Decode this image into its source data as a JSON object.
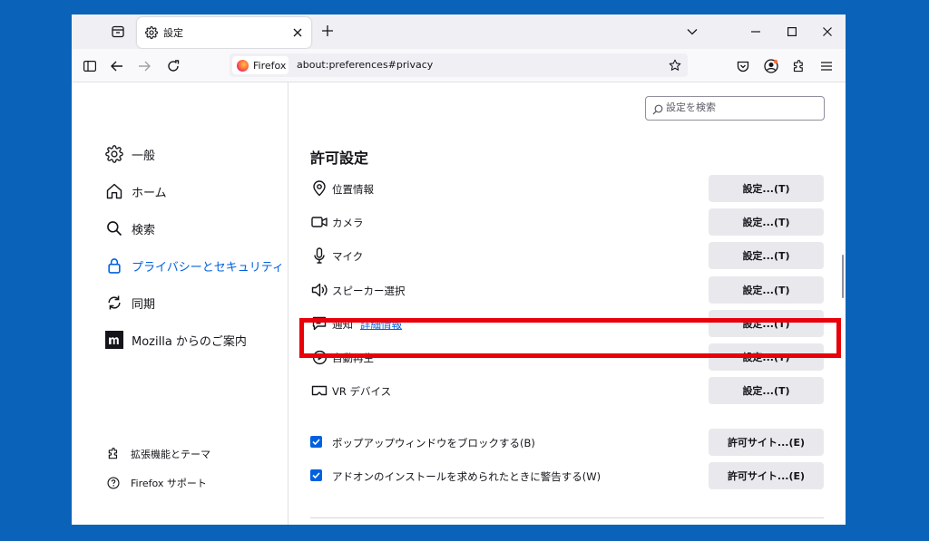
{
  "browser": {
    "tab_title": "設定",
    "identity_label": "Firefox",
    "url": "about:preferences#privacy"
  },
  "sidebar": {
    "categories": [
      {
        "label": "一般",
        "icon": "gear-icon"
      },
      {
        "label": "ホーム",
        "icon": "home-icon"
      },
      {
        "label": "検索",
        "icon": "search-icon"
      },
      {
        "label": "プライバシーとセキュリティ",
        "icon": "lock-icon",
        "selected": true
      },
      {
        "label": "同期",
        "icon": "sync-icon"
      },
      {
        "label": "Mozilla からのご案内",
        "icon": "mozilla-icon"
      }
    ],
    "footer": [
      {
        "label": "拡張機能とテーマ",
        "icon": "puzzle-icon"
      },
      {
        "label": "Firefox サポート",
        "icon": "help-icon"
      }
    ]
  },
  "search": {
    "placeholder": "設定を検索"
  },
  "permissions": {
    "heading": "許可設定",
    "button_label": "設定...(T)",
    "items": [
      {
        "label": "位置情報",
        "icon": "location-icon"
      },
      {
        "label": "カメラ",
        "icon": "camera-icon"
      },
      {
        "label": "マイク",
        "icon": "microphone-icon"
      },
      {
        "label": "スピーカー選択",
        "icon": "speaker-icon"
      },
      {
        "label": "通知",
        "icon": "notification-icon",
        "link": "詳細情報"
      },
      {
        "label": "自動再生",
        "icon": "autoplay-icon"
      },
      {
        "label": "VR デバイス",
        "icon": "vr-icon"
      }
    ],
    "checkboxes": [
      {
        "label": "ポップアップウィンドウをブロックする(B)",
        "checked": true,
        "button": "許可サイト...(E)"
      },
      {
        "label": "アドオンのインストールを求められたときに警告する(W)",
        "checked": true,
        "button": "許可サイト...(E)"
      }
    ]
  },
  "colors": {
    "accent": "#0061e0",
    "highlight": "#e8000a",
    "desktop": "#0a63b8"
  }
}
